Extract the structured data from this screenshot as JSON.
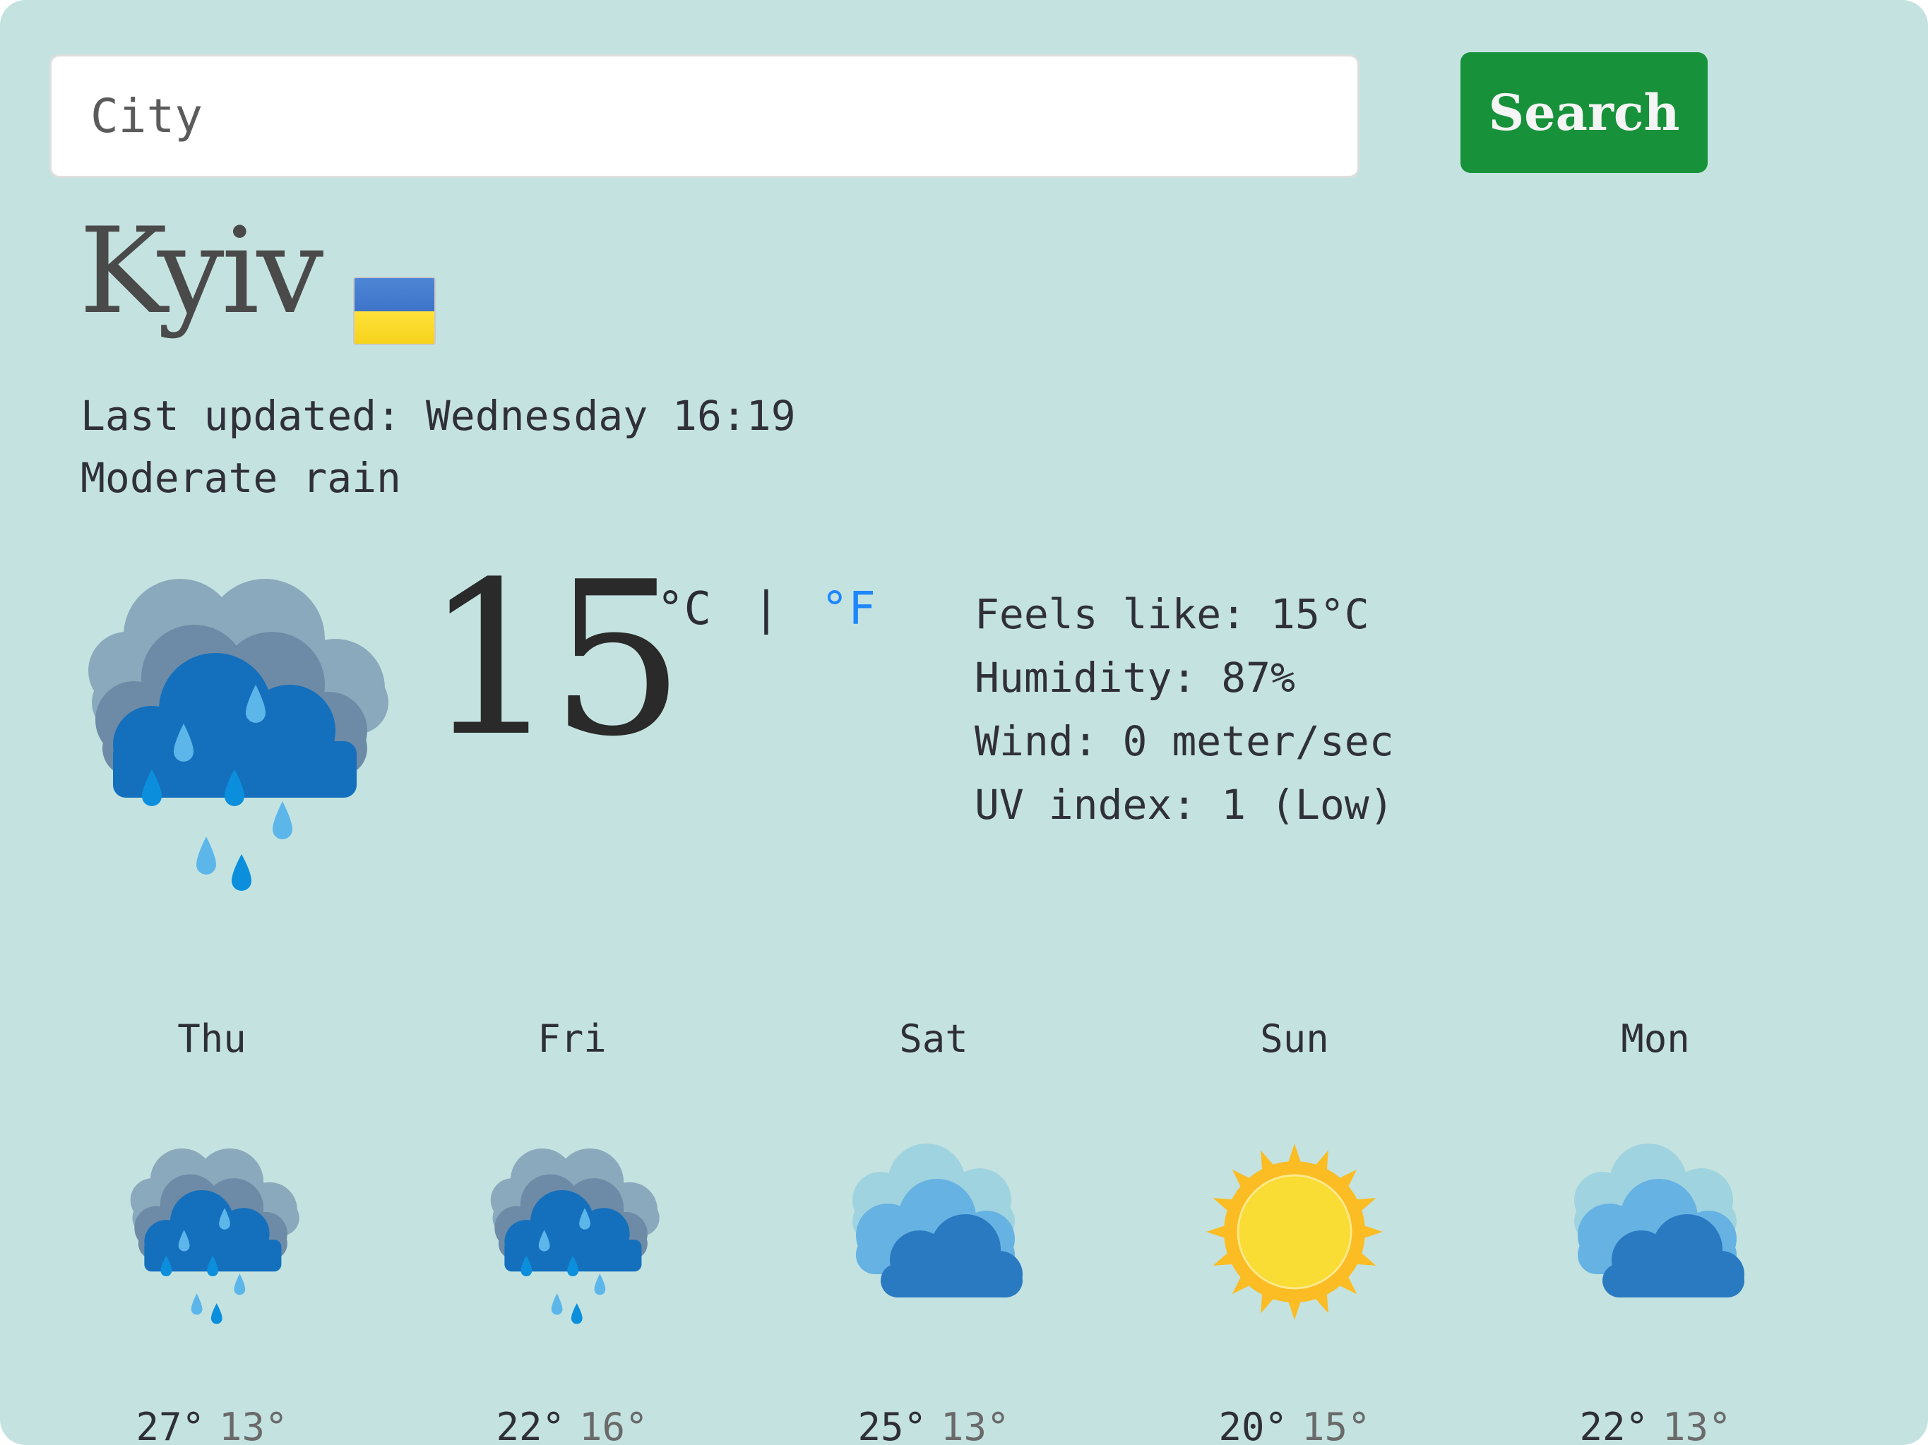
{
  "search": {
    "placeholder": "City",
    "button_label": "Search"
  },
  "location": {
    "city": "Kyiv",
    "flag": "ukraine-flag"
  },
  "status": {
    "last_updated": "Last updated: Wednesday 16:19",
    "condition": "Moderate rain"
  },
  "current": {
    "temperature": "15",
    "unit_c": "°C",
    "unit_separator": "|",
    "unit_f": "°F",
    "icon": "rain-cloud-icon",
    "details": {
      "feels_like": "Feels like: 15°C",
      "humidity": "Humidity: 87%",
      "wind": "Wind: 0 meter/sec",
      "uv_index": "UV index: 1 (Low)"
    }
  },
  "forecast": [
    {
      "day": "Thu",
      "icon": "rain-cloud-icon",
      "high": "27°",
      "low": "13°"
    },
    {
      "day": "Fri",
      "icon": "rain-cloud-icon",
      "high": "22°",
      "low": "16°"
    },
    {
      "day": "Sat",
      "icon": "cloudy-icon",
      "high": "25°",
      "low": "13°"
    },
    {
      "day": "Sun",
      "icon": "sun-icon",
      "high": "20°",
      "low": "15°"
    },
    {
      "day": "Mon",
      "icon": "cloudy-icon",
      "high": "22°",
      "low": "13°"
    }
  ],
  "colors": {
    "background": "#c4e3e0",
    "search_button": "#17923a",
    "unit_link": "#1e86ff",
    "flag_blue": "#3d74c8",
    "flag_yellow": "#f5d21c"
  }
}
